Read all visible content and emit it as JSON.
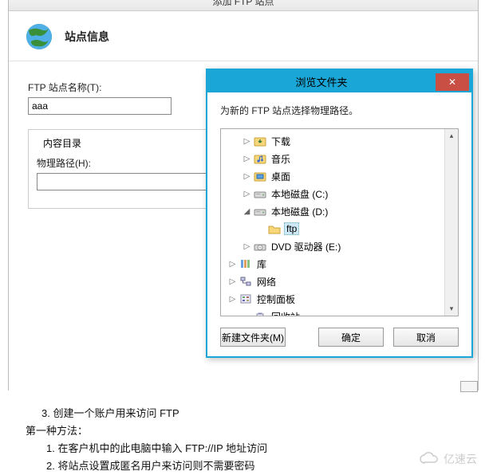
{
  "wizard": {
    "header": "添加 FTP 站点",
    "title": "站点信息",
    "siteNameLabel": "FTP 站点名称(T):",
    "siteNameValue": "aaa",
    "contentGroup": "内容目录",
    "pathLabel": "物理路径(H):",
    "pathValue": ""
  },
  "dialog": {
    "title": "浏览文件夹",
    "message": "为新的 FTP 站点选择物理路径。",
    "tree": [
      {
        "indent": 1,
        "expand": "▷",
        "icon": "download-folder",
        "label": "下载"
      },
      {
        "indent": 1,
        "expand": "▷",
        "icon": "music-folder",
        "label": "音乐"
      },
      {
        "indent": 1,
        "expand": "▷",
        "icon": "desktop-folder",
        "label": "桌面"
      },
      {
        "indent": 1,
        "expand": "▷",
        "icon": "drive-icon",
        "label": "本地磁盘 (C:)"
      },
      {
        "indent": 1,
        "expand": "◢",
        "icon": "drive-icon",
        "label": "本地磁盘 (D:)"
      },
      {
        "indent": 2,
        "expand": "",
        "icon": "folder-icon",
        "label": "ftp",
        "selected": true
      },
      {
        "indent": 1,
        "expand": "▷",
        "icon": "dvd-icon",
        "label": "DVD 驱动器 (E:)"
      },
      {
        "indent": 0,
        "expand": "▷",
        "icon": "library-icon",
        "label": "库"
      },
      {
        "indent": 0,
        "expand": "▷",
        "icon": "network-icon",
        "label": "网络"
      },
      {
        "indent": 0,
        "expand": "▷",
        "icon": "control-panel-icon",
        "label": "控制面板"
      },
      {
        "indent": 1,
        "expand": "",
        "icon": "recycle-icon",
        "label": "回收站"
      }
    ],
    "newFolder": "新建文件夹(M)",
    "ok": "确定",
    "cancel": "取消"
  },
  "notes": {
    "n3": "3. 创建一个账户用来访问 FTP",
    "m1": "第一种方法：",
    "s1": "1. 在客户机中的此电脑中输入 FTP://IP 地址访问",
    "s2": "2. 将站点设置成匿名用户来访问则不需要密码"
  },
  "watermark": "亿速云"
}
